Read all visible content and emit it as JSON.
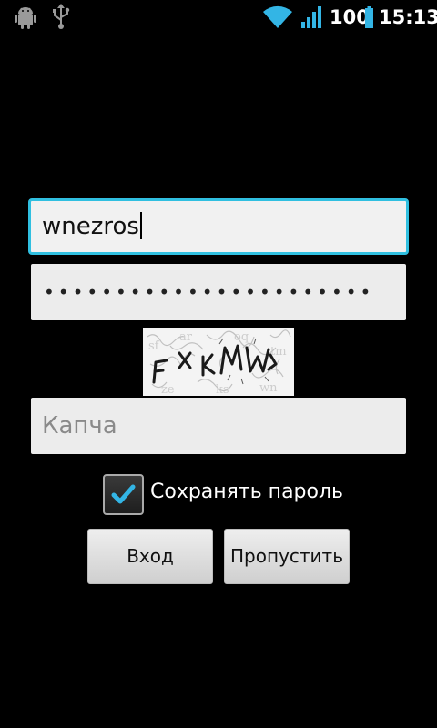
{
  "status_bar": {
    "icons": [
      "android-debug-icon",
      "usb-icon",
      "wifi-icon",
      "signal-icon",
      "battery-icon"
    ],
    "battery_level": "100",
    "clock": "15:13"
  },
  "form": {
    "username_value": "wnezros",
    "password_value": "•••••••••••••••••••••••",
    "captcha_text": "FXKMW",
    "captcha_placeholder": "Капча",
    "remember_label": "Сохранять пароль",
    "remember_checked": true,
    "login_label": "Вход",
    "skip_label": "Пропустить"
  },
  "colors": {
    "focus_border": "#30bfe0",
    "checkmark": "#33b5e5",
    "background": "#000000"
  }
}
